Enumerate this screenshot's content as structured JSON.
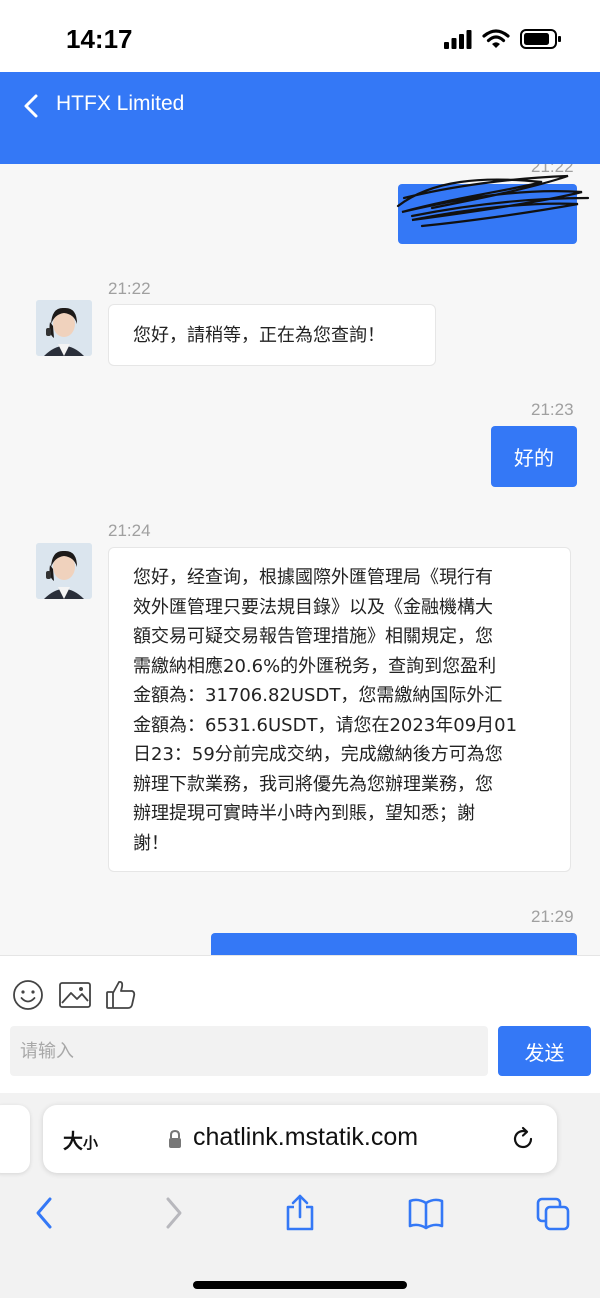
{
  "status_bar": {
    "time": "14:17"
  },
  "header": {
    "title": "HTFX Limited"
  },
  "messages": [
    {
      "direction": "out",
      "time": "21:22",
      "redacted": true
    },
    {
      "direction": "in",
      "time": "21:22",
      "text": "您好，請稍等，正在為您查詢！"
    },
    {
      "direction": "out",
      "time": "21:23",
      "text": "好的"
    },
    {
      "direction": "in",
      "time": "21:24",
      "lines": [
        "您好，经查询，根據國際外匯管理局《現行有",
        "效外匯管理只要法規目錄》以及《金融機構大",
        "額交易可疑交易報告管理措施》相關規定，您",
        "需繳納相應20.6%的外匯税务，查詢到您盈利",
        "金額為：31706.82USDT，您需繳納国际外汇",
        "金額為：6531.6USDT，请您在2023年09月01",
        "日23：59分前完成交纳，完成繳納後方可為您",
        "辦理下款業務，我司將優先為您辦理業務，您",
        "辦理提現可實時半小時內到賬，望知悉；謝",
        "謝！"
      ]
    },
    {
      "direction": "out",
      "time": "21:29"
    }
  ],
  "composer": {
    "input_placeholder": "请输入",
    "send_label": "发送",
    "tools": [
      "emoji-icon",
      "image-icon",
      "thumbs-up-icon"
    ]
  },
  "browser": {
    "text_size_big": "大",
    "text_size_small": "小",
    "url": "chatlink.mstatik.com"
  },
  "colors": {
    "accent": "#3478f6",
    "background": "#f7f7f7",
    "timestamp": "#a0a0a0"
  }
}
